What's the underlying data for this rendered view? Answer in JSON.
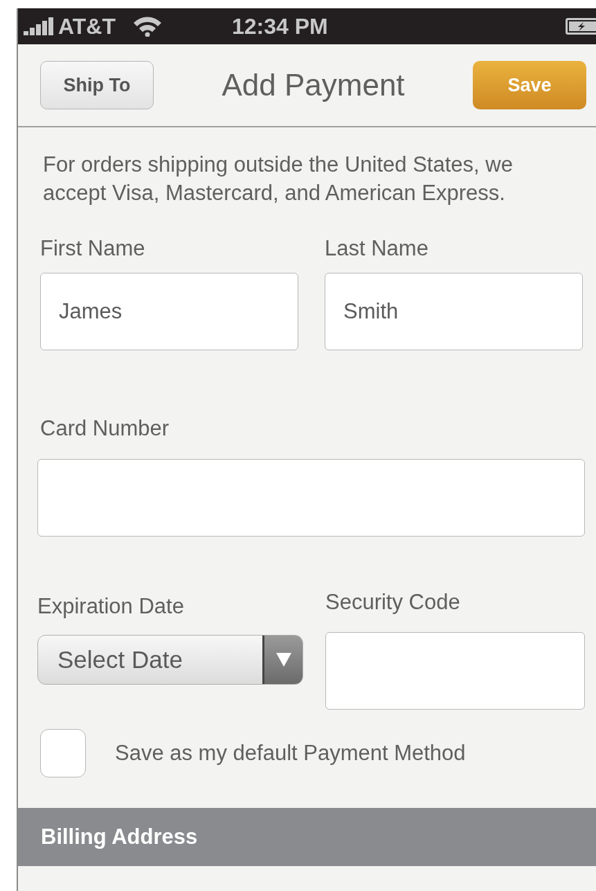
{
  "status_bar": {
    "carrier": "AT&T",
    "time": "12:34 PM"
  },
  "nav_bar": {
    "back_button": "Ship To",
    "title": "Add Payment",
    "save_button": "Save"
  },
  "notice": "For orders shipping outside the United States, we accept Visa, Mastercard, and American Express.",
  "name_fields": [
    {
      "label": "First Name",
      "value": "James"
    },
    {
      "label": "Last Name",
      "value": "Smith"
    }
  ],
  "card_number": {
    "label": "Card Number"
  },
  "expiration": {
    "label": "Expiration Date",
    "value": "Select Date"
  },
  "security_code": {
    "label": "Security Code"
  },
  "default_checkbox": {
    "label": "Save as my default Payment Method",
    "checked": false
  },
  "section_header": "Billing Address"
}
